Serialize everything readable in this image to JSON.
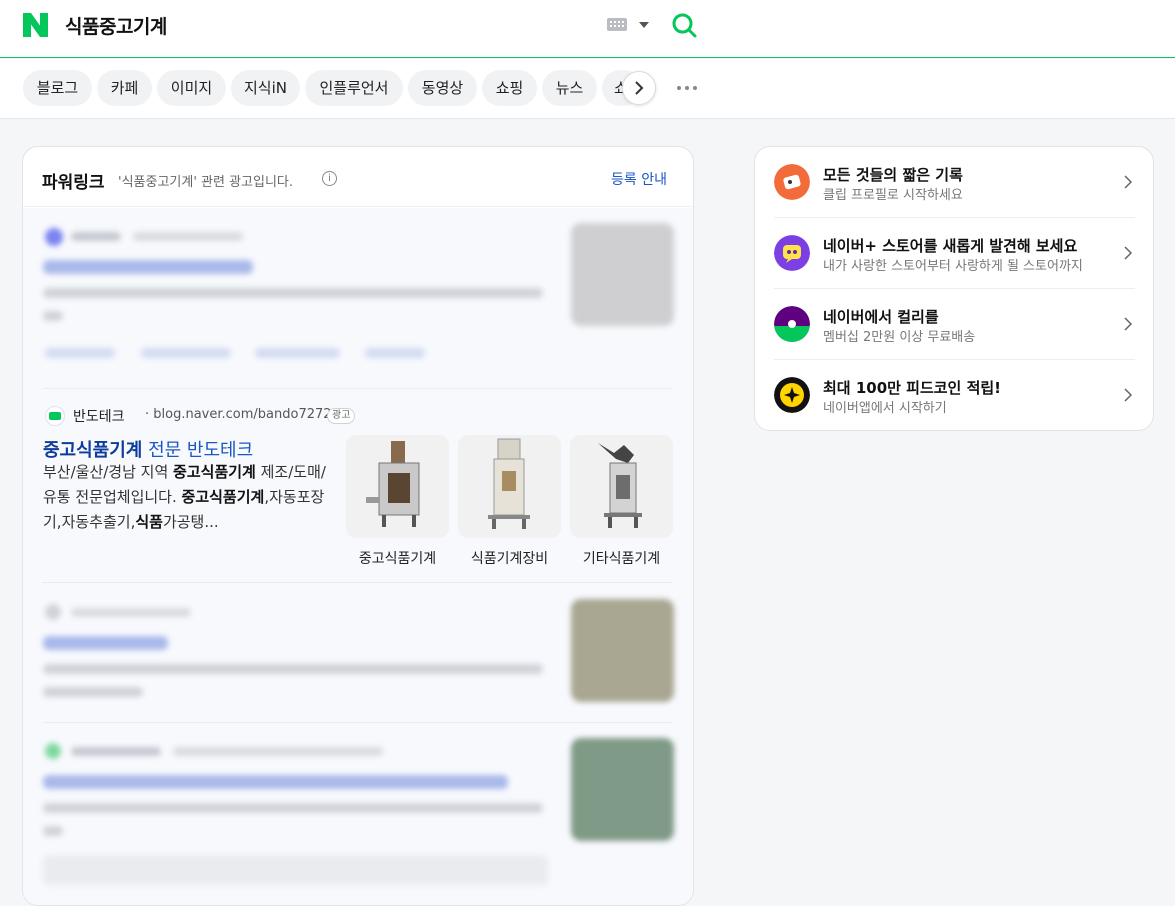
{
  "header": {
    "query": "식품중고기계"
  },
  "tabs": [
    "블로그",
    "카페",
    "이미지",
    "지식iN",
    "인플루언서",
    "동영상",
    "쇼핑",
    "뉴스",
    "쇼"
  ],
  "powerlink": {
    "title": "파워링크",
    "description": "'식품중고기계' 관련 광고입니다.",
    "info_glyph": "i",
    "register_label": "등록 안내",
    "ad": {
      "site_name": "반도테크",
      "url": "· blog.naver.com/bando7272",
      "badge": "광고",
      "title_bold": "중고식품기계",
      "title_rest": " 전문 반도테크",
      "text": {
        "p1": "부산/울산/경남 지역 ",
        "b1": "중고식품기계",
        "p2": " 제조/도매/유통 전문업체입니다. ",
        "b2": "중고식품기계",
        "p3": ",자동포장기,자동추출기,",
        "b3": "식품",
        "p4": "가공탱..."
      },
      "thumbnails": [
        {
          "label": "중고식품기계"
        },
        {
          "label": "식품기계장비"
        },
        {
          "label": "기타식품기계"
        }
      ]
    }
  },
  "side": {
    "items": [
      {
        "title": "모든 것들의 짧은 기록",
        "subtitle": "클립 프로필로 시작하세요",
        "icon": "clip-icon",
        "color": "#f26b3a"
      },
      {
        "title": "네이버+ 스토어를 새롭게 발견해 보세요",
        "subtitle": "내가 사랑한 스토어부터 사랑하게 될 스토어까지",
        "icon": "store-icon",
        "color": "#7b3fe4"
      },
      {
        "title": "네이버에서 컬리를",
        "subtitle": "멤버십 2만원 이상 무료배송",
        "icon": "kurly-icon",
        "color": "#5f0080"
      },
      {
        "title": "최대 100만 피드코인 적립!",
        "subtitle": "네이버앱에서 시작하기",
        "icon": "coin-icon",
        "color": "#ffd400"
      }
    ]
  },
  "colors": {
    "brand": "#03c75a",
    "link": "#1a56c4"
  }
}
